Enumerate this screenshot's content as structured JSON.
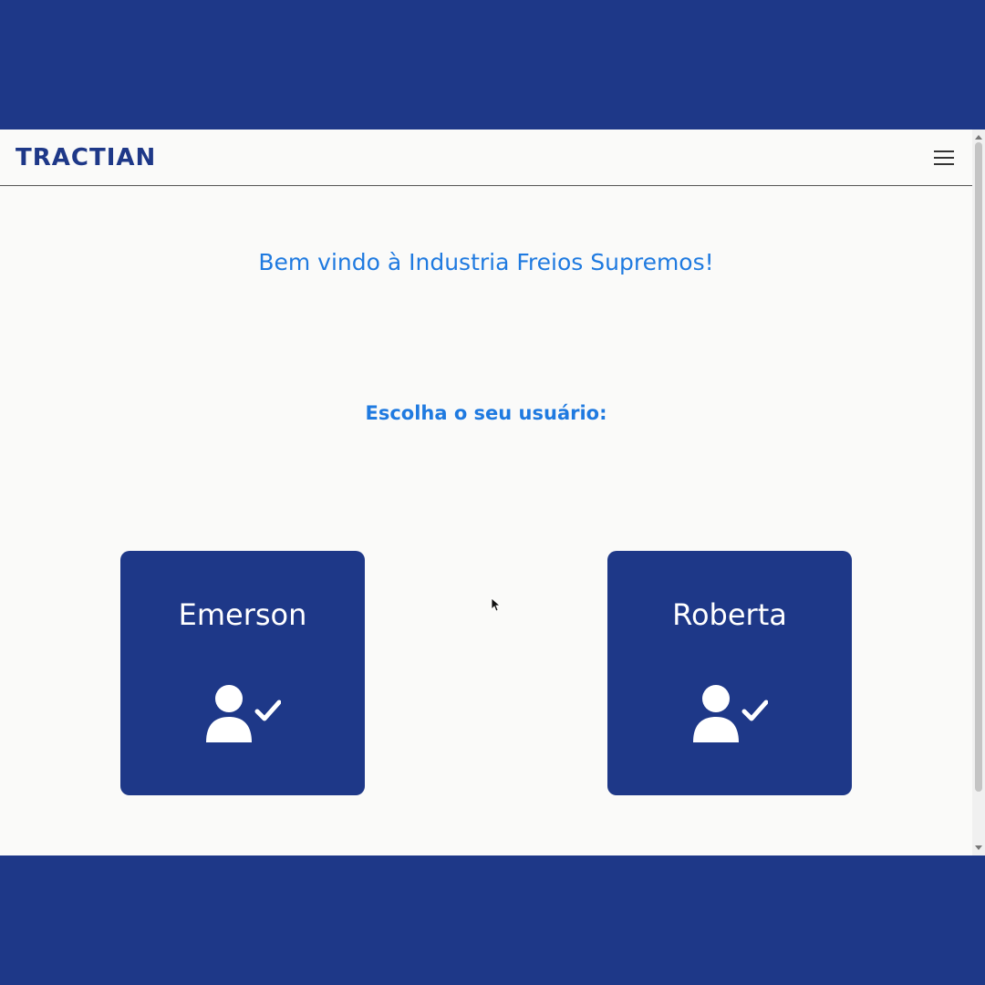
{
  "app": {
    "logo_text": "TRACTIAN",
    "colors": {
      "brand_navy": "#1e3888",
      "heading_blue": "#1f7ae0",
      "page_background": "#fafaf9"
    }
  },
  "header": {
    "menu_icon": "hamburger-menu-icon"
  },
  "main": {
    "welcome": "Bem vindo à Industria Freios Supremos!",
    "choose_prompt": "Escolha o seu usuário:",
    "users": [
      {
        "name": "Emerson",
        "icon": "user-check-icon"
      },
      {
        "name": "Roberta",
        "icon": "user-check-icon"
      }
    ]
  }
}
